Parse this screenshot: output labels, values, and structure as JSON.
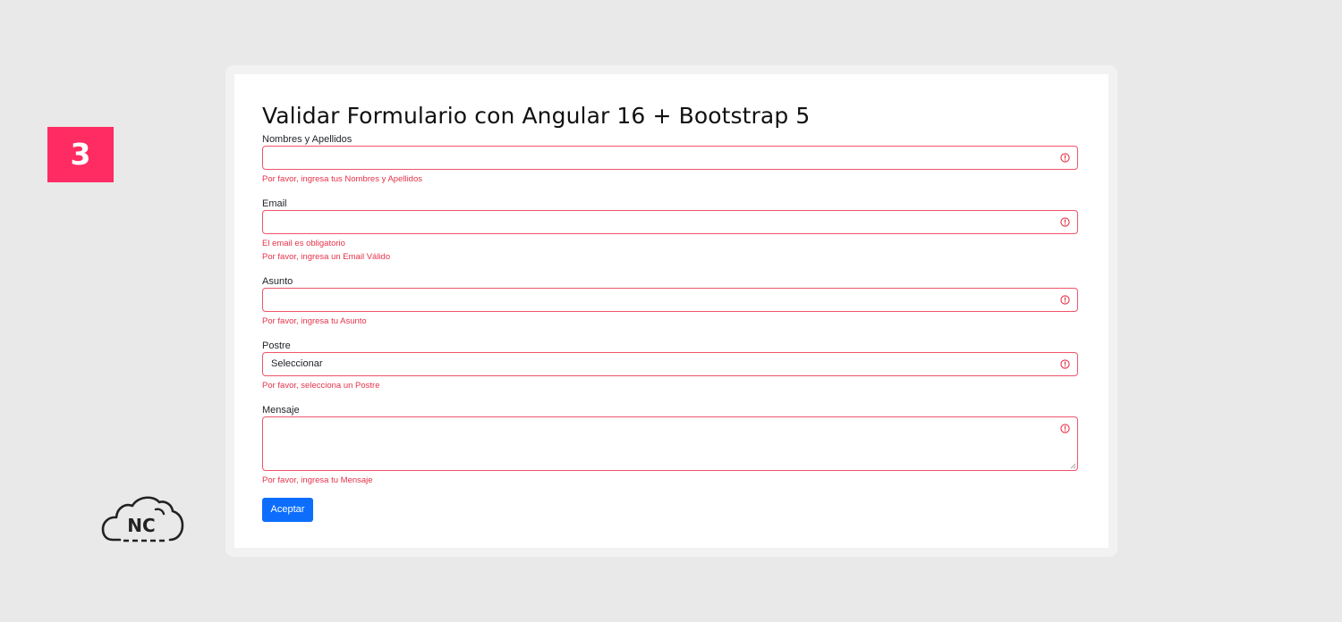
{
  "step_badge": "3",
  "logo": {
    "text": "NC",
    "icon": "cloud-icon"
  },
  "colors": {
    "badge": "#ff2b63",
    "invalid": "#e5334a",
    "primary_button": "#0d6efd"
  },
  "form": {
    "title": "Validar Formulario con Angular 16 + Bootstrap 5",
    "fields": {
      "names": {
        "label": "Nombres y Apellidos",
        "value": "",
        "errors": [
          "Por favor, ingresa tus Nombres y Apellidos"
        ]
      },
      "email": {
        "label": "Email",
        "value": "",
        "errors": [
          "El email es obligatorio",
          "Por favor, ingresa un Email Válido"
        ]
      },
      "subject": {
        "label": "Asunto",
        "value": "",
        "errors": [
          "Por favor, ingresa tu Asunto"
        ]
      },
      "dessert": {
        "label": "Postre",
        "selected": "Seleccionar",
        "errors": [
          "Por favor, selecciona un Postre"
        ]
      },
      "message": {
        "label": "Mensaje",
        "value": "",
        "errors": [
          "Por favor, ingresa tu Mensaje"
        ]
      }
    },
    "submit_label": "Aceptar"
  }
}
